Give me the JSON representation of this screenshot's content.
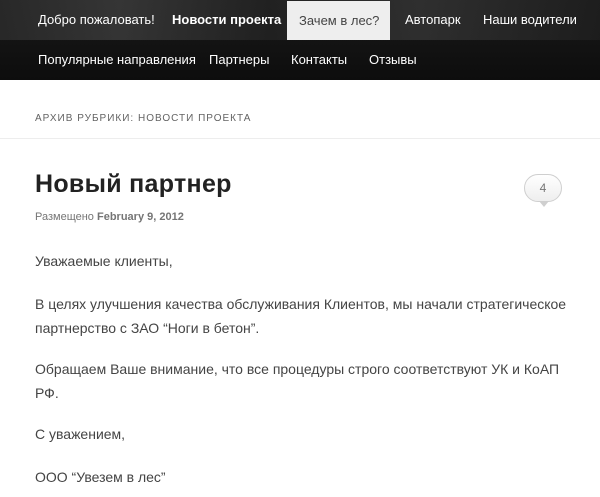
{
  "nav": {
    "row1": [
      "Добро пожаловать!",
      "Новости проекта",
      "Зачем в лес?",
      "Автопарк",
      "Наши водители"
    ],
    "row2": [
      "Популярные направления",
      "Партнеры",
      "Контакты",
      "Отзывы"
    ]
  },
  "archive": {
    "title": "Архив рубрики: Новости проекта"
  },
  "post": {
    "title": "Новый партнер",
    "comments": "4",
    "meta_prefix": "Размещено",
    "date": "February 9, 2012",
    "p1": "Уважаемые клиенты,",
    "p2": "В целях улучшения качества обслуживания Клиентов, мы начали стратегическое партнерство с ЗАО “Ноги в бетон”.",
    "p3": "Обращаем Ваше внимание, что все процедуры строго соответствуют УК и КоАП РФ.",
    "p4": "С уважением,",
    "p5": "ООО “Увезем в лес”"
  },
  "colors": {
    "navbar": "#111111",
    "active_tab": "#eeeeee",
    "text": "#444444",
    "title": "#222222"
  }
}
